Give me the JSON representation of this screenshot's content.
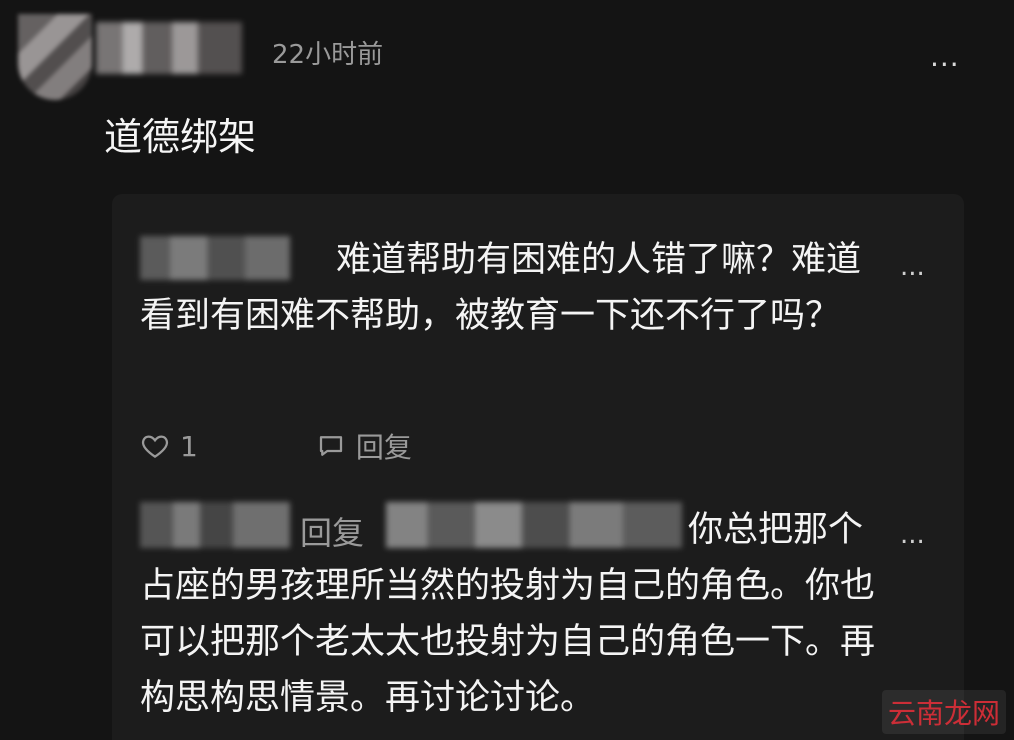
{
  "comment": {
    "timestamp": "22小时前",
    "more_label": "...",
    "text": "道德绑架"
  },
  "replies": [
    {
      "text": "难道帮助有困难的人错了嘛？难道看到有困难不帮助，被教育一下还不行了吗？",
      "more_label": "...",
      "like_count": "1",
      "reply_label": "回复"
    },
    {
      "reply_prefix": "回复",
      "text": "你总把那个占座的男孩理所当然的投射为自己的角色。你也可以把那个老太太也投射为自己的角色一下。再构思构思情景。再讨论讨论。",
      "more_label": "..."
    }
  ],
  "watermark": "云南龙网",
  "colors": {
    "background": "#141414",
    "card": "#1c1c1c",
    "text": "#f4f4f4",
    "muted": "#9a9a9a",
    "watermark": "#e0303a"
  }
}
